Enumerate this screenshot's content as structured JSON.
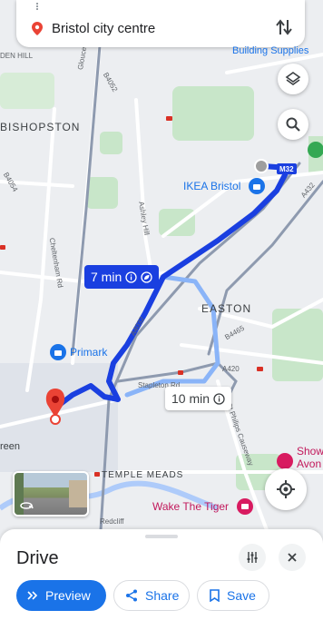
{
  "search": {
    "destination": "Bristol city centre",
    "partial_top_label": "Building Supplies"
  },
  "map_labels": {
    "areas": [
      "BISHOPSTON",
      "EASTON",
      "TEMPLE MEADS"
    ],
    "streets": [
      "DEN HILL",
      "Gloucester Rd",
      "B4052",
      "B4054",
      "Ashley Hill",
      "Cheltenham Rd",
      "A4032",
      "A432",
      "B4465",
      "A420",
      "Stapleton Rd",
      "Lawrence Hill",
      "St Philips Causeway",
      "A4032",
      "M32",
      "reen",
      "Redcliff"
    ],
    "pois": [
      "IKEA Bristol",
      "Primark",
      "Wake The Tiger",
      "Show Avon"
    ]
  },
  "routes": {
    "primary": {
      "time": "7 min",
      "color": "#1a3fe0"
    },
    "alternate": {
      "time": "10 min",
      "color": "#8ab4f8"
    }
  },
  "colors": {
    "accent": "#1a73e8",
    "route": "#1a3fe0",
    "pin": "#ea4335",
    "park": "#c8e6c9"
  },
  "icons": [
    "location-pin-icon",
    "swap-icon",
    "layers-icon",
    "search-icon",
    "recenter-icon",
    "eco-leaf-icon",
    "info-icon",
    "tune-icon",
    "close-icon",
    "navigation-chevrons-icon",
    "share-icon",
    "bookmark-icon",
    "street-view-icon"
  ],
  "sheet": {
    "title": "Drive",
    "preview_label": "Preview",
    "share_label": "Share",
    "save_label": "Save"
  }
}
